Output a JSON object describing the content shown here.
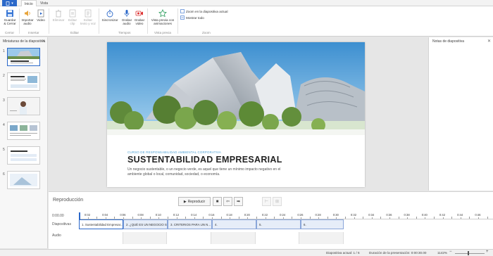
{
  "tabs": {
    "file_arrow": "▾",
    "items": [
      {
        "label": "Inicio",
        "active": true
      },
      {
        "label": "Vista",
        "active": false
      }
    ]
  },
  "ribbon": {
    "buttons": {
      "save_close": "Guardar\n& Cerrar",
      "import_audio": "Importar\naudio",
      "video": "Video",
      "remove": "Eliminar",
      "edit_clip": "Editar\nclip",
      "edit_text": "Editar\ntexto y voz",
      "sync": "Sincronizar",
      "record_audio": "Grabar\naudio",
      "record_video": "Grabar\nvideo",
      "preview": "Vista previa con\nanimaciones",
      "zoom_to_current": "Zoom en la diapositiva actual",
      "show_all": "Mostrar todo"
    },
    "groups": {
      "close": "Cerrar",
      "insert": "Insertar",
      "edit": "Editar",
      "times": "Tiempos",
      "preview": "Vista previa",
      "zoom": "Zoom"
    }
  },
  "thumbnails": {
    "title": "Miniaturas de la diapositiva",
    "close": "✕",
    "items": [
      {
        "num": "1"
      },
      {
        "num": "2"
      },
      {
        "num": "3"
      },
      {
        "num": "4"
      },
      {
        "num": "5"
      },
      {
        "num": "6"
      }
    ]
  },
  "slide": {
    "kicker": "CURSO DE RESPONSABILIDAD AMBIENTAL CORPORATIVA",
    "title": "SUSTENTABILIDAD EMPRESARIAL",
    "body": "Un negocio sustentable, o un negocio verde, es aquel que tiene un mínimo impacto negativo en el ambiente global o local, comunidad, sociedad, o economía."
  },
  "notes": {
    "title": "Notas de diapositiva",
    "close": "✕"
  },
  "playback": {
    "title": "Reproducción",
    "play_label": "Reproducir",
    "timecode": "0:00.00",
    "rows": {
      "slides": "Diapositivas",
      "audio": "Audio"
    },
    "ticks": [
      "0:02",
      "0:04",
      "0:06",
      "0:08",
      "0:10",
      "0:12",
      "0:14",
      "0:16",
      "0:18",
      "0:20",
      "0:22",
      "0:24",
      "0:26",
      "0:28",
      "0:30",
      "0:32",
      "0:34",
      "0:36",
      "0:38",
      "0:40",
      "0:42",
      "0:44",
      "0:46"
    ],
    "clips": [
      "1. Sustentabilidad Empresar...",
      "2. ¿QUÉ ES UN NEGOCIO S...",
      "3. CRITERIOS PARA  UN N...",
      "4.",
      "5.",
      "6."
    ]
  },
  "status": {
    "current_slide": "Diapositiva actual: 1 / 6",
    "duration": "Duración de la presentación: 0:00:30.00",
    "zoom": "1142%"
  },
  "colors": {
    "accent": "#2b68c9",
    "kicker": "#4a9fd3"
  }
}
